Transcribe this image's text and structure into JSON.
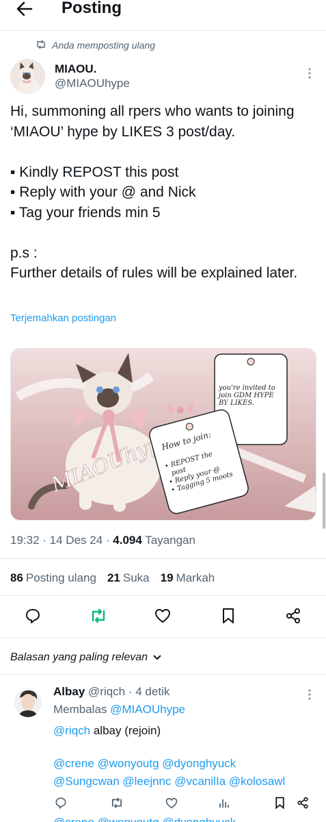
{
  "header": {
    "title": "Posting"
  },
  "repost": {
    "label": "Anda memposting ulang"
  },
  "post": {
    "display_name": "MIAOU.",
    "handle": "@MIAOUhype",
    "text": "Hi, summoning all rpers who wants to joining ‘MIAOU’ hype by LIKES 3 post/day.\n\n▪ Kindly REPOST this post\n▪ Reply with your @ and Nick\n▪ Tag your friends min 5\n\np.s :\nFurther details of rules will be explained later.",
    "translate": "Terjemahkan postingan",
    "image": {
      "brand": "MIAOUhype",
      "card_invite": "you're invited to join GDM HYPE BY LIKES.",
      "card_title": "How to join:",
      "card_items": [
        "REPOST the post",
        "Reply your @",
        "Tagging 5 moots"
      ]
    },
    "time": "19:32",
    "date": "14 Des 24",
    "views": "4.094",
    "views_label": "Tayangan",
    "reposts": "86",
    "reposts_label": "Posting ulang",
    "likes": "21",
    "likes_label": "Suka",
    "bookmarks": "19",
    "bookmarks_label": "Markah"
  },
  "replies": {
    "sort_label": "Balasan yang paling relevan",
    "items": [
      {
        "name": "Albay",
        "handle": "@riqch",
        "time": "4 detik",
        "reply_to_label": "Membalas",
        "reply_to": "@MIAOUhype",
        "mention": "@riqch",
        "text": "albay (rejoin)",
        "mentions_1": "@crene @wonyoutg @dyonghyuck",
        "mentions_2": "@Sungcwan @leejnnc @vcanilIa @kolosawl",
        "mentions_3": "@crene @wonyoutg @dyonghyuck"
      }
    ]
  },
  "colors": {
    "accent": "#1d9bf0",
    "repost_active": "#00ba7c",
    "text": "#0f1419",
    "muted": "#536471"
  },
  "icons": [
    "back-arrow-icon",
    "repost-icon",
    "more-vertical-icon",
    "reply-icon",
    "like-icon",
    "bookmark-icon",
    "share-icon",
    "chevron-down-icon",
    "views-icon"
  ]
}
